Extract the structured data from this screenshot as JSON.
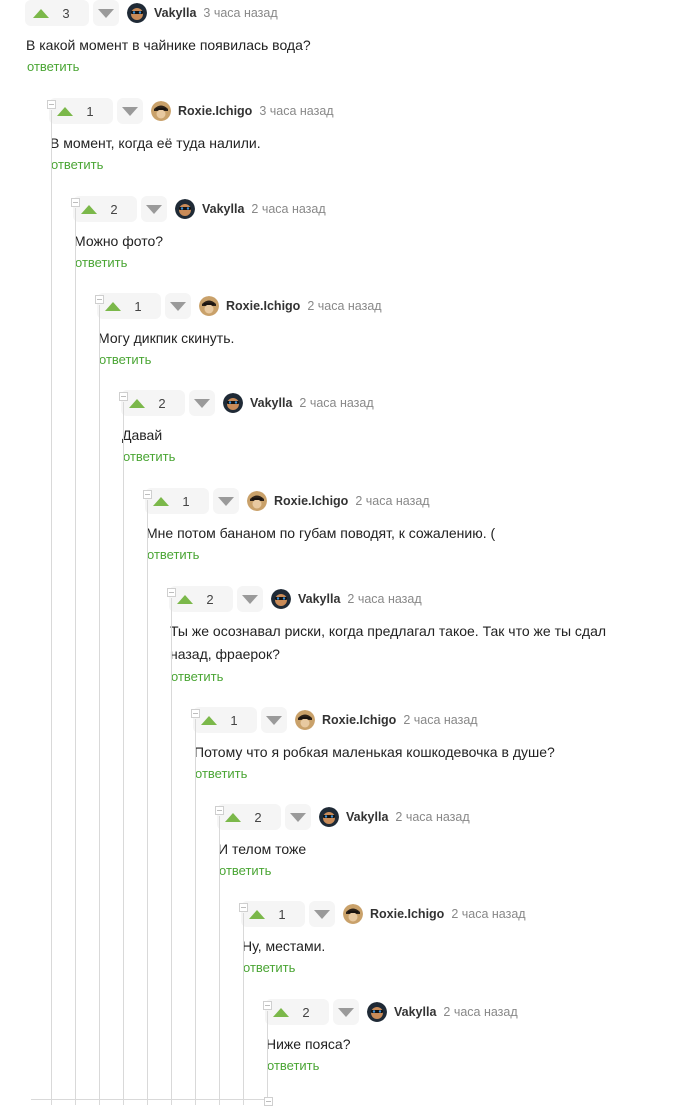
{
  "comments": [
    {
      "score": "3",
      "author": "Vakylla",
      "time": "3 часа назад",
      "text": "В какой момент в чайнике появилась вода?",
      "reply": "ответить"
    },
    {
      "score": "1",
      "author": "Roxie.Ichigo",
      "time": "3 часа назад",
      "text": "В момент, когда её туда налили.",
      "reply": "ответить"
    },
    {
      "score": "2",
      "author": "Vakylla",
      "time": "2 часа назад",
      "text": "Можно фото?",
      "reply": "ответить"
    },
    {
      "score": "1",
      "author": "Roxie.Ichigo",
      "time": "2 часа назад",
      "text": "Могу дикпик скинуть.",
      "reply": "ответить"
    },
    {
      "score": "2",
      "author": "Vakylla",
      "time": "2 часа назад",
      "text": "Давай",
      "reply": "ответить"
    },
    {
      "score": "1",
      "author": "Roxie.Ichigo",
      "time": "2 часа назад",
      "text": "Мне потом бананом по губам поводят, к сожалению. (",
      "reply": "ответить"
    },
    {
      "score": "2",
      "author": "Vakylla",
      "time": "2 часа назад",
      "text": "Ты же осознавал риски, когда предлагал такое. Так что же ты сдал\nназад, фраерок?",
      "reply": "ответить"
    },
    {
      "score": "1",
      "author": "Roxie.Ichigo",
      "time": "2 часа назад",
      "text": "Потому что я робкая маленькая кошкодевочка в душе?",
      "reply": "ответить"
    },
    {
      "score": "2",
      "author": "Vakylla",
      "time": "2 часа назад",
      "text": "И телом тоже",
      "reply": "ответить"
    },
    {
      "score": "1",
      "author": "Roxie.Ichigo",
      "time": "2 часа назад",
      "text": "Ну, местами.",
      "reply": "ответить"
    },
    {
      "score": "2",
      "author": "Vakylla",
      "time": "2 часа назад",
      "text": "Ниже пояса?",
      "reply": "ответить"
    }
  ],
  "colors": {
    "upvote": "#7bb84a",
    "reply_link": "#4aa534",
    "thread_line": "#d9d9d9"
  },
  "icons": {
    "upvote": "triangle-up-icon",
    "downvote": "triangle-down-icon",
    "collapse": "minus-square-icon"
  }
}
